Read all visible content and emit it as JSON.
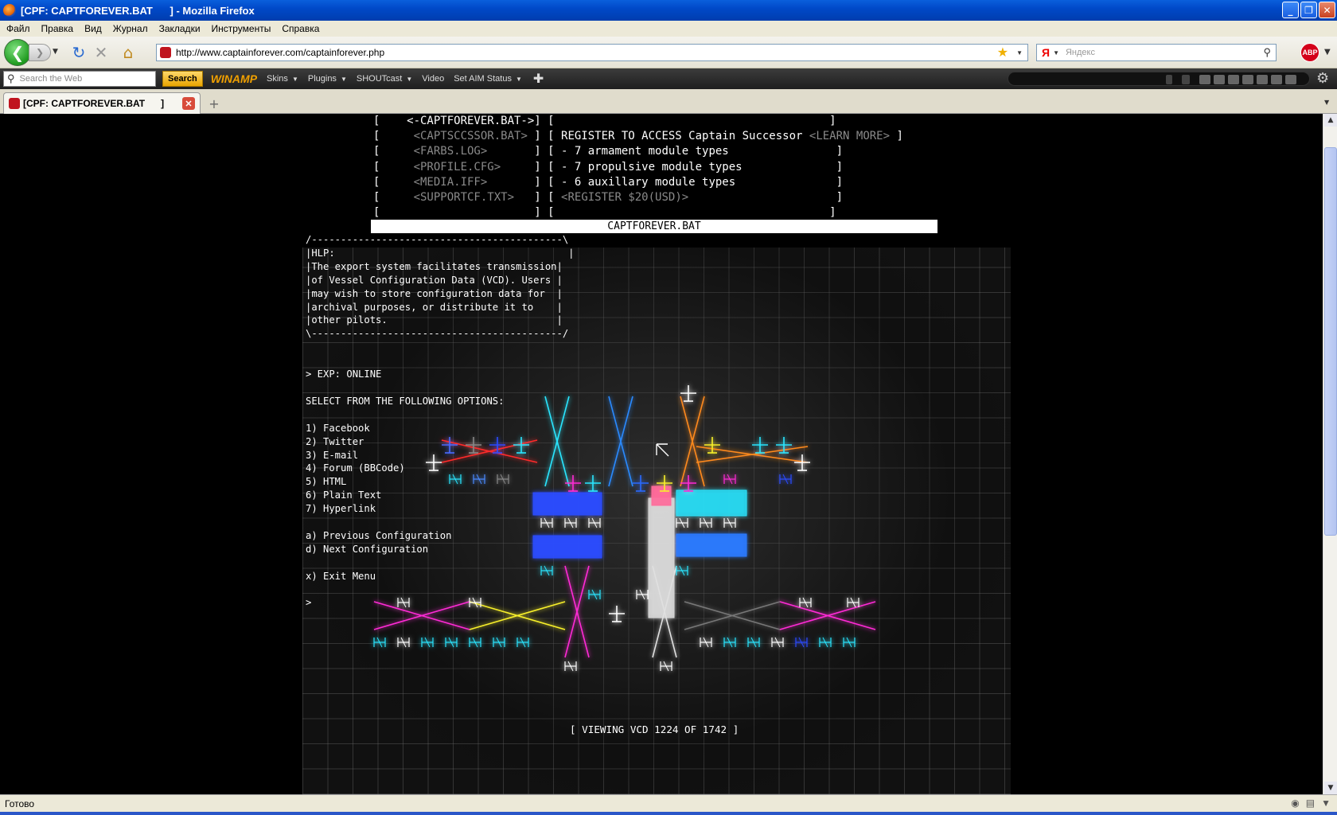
{
  "window": {
    "title": "[CPF: CAPTFOREVER.BAT      ] - Mozilla Firefox",
    "minimize": "_",
    "maximize": "❐",
    "close": "✕"
  },
  "menubar": [
    "Файл",
    "Правка",
    "Вид",
    "Журнал",
    "Закладки",
    "Инструменты",
    "Справка"
  ],
  "nav": {
    "url": "http://www.captainforever.com/captainforever.php",
    "search_engine_glyph": "Я",
    "search_placeholder": "Яндекс",
    "abp": "ABP"
  },
  "winamp": {
    "search_placeholder": "Search the Web",
    "search_button": "Search",
    "logo": "WINAMP",
    "items": [
      "Skins",
      "Plugins",
      "SHOUTcast",
      "Video",
      "Set AIM Status"
    ]
  },
  "tab": {
    "label": "[CPF: CAPTFOREVER.BAT      ]"
  },
  "game_menu": {
    "lines": [
      "[    <-CAPTFOREVER.BAT->] [                                         ]",
      "[     <CAPTSCCSSOR.BAT> ] [ REGISTER TO ACCESS Captain Successor <LEARN MORE> ]",
      "[     <FARBS.LOG>       ] [ - 7 armament module types                ]",
      "[     <PROFILE.CFG>     ] [ - 7 propulsive module types              ]",
      "[     <MEDIA.IFF>       ] [ - 6 auxillary module types               ]",
      "[     <SUPPORTCF.TXT>   ] [ <REGISTER $20(USD)>                      ]",
      "[                       ] [                                         ]"
    ],
    "links": [
      "<CAPTSCCSSOR.BAT>",
      "<FARBS.LOG>",
      "<PROFILE.CFG>",
      "<MEDIA.IFF>",
      "<SUPPORTCF.TXT>",
      "<LEARN MORE>",
      "<REGISTER $20(USD)>"
    ],
    "title_bar": "CAPTFOREVER.BAT"
  },
  "console": {
    "text": "/-------------------------------------------\\\n|HLP:                                        |\n|The export system facilitates transmission|\n|of Vessel Configuration Data (VCD). Users |\n|may wish to store configuration data for  |\n|archival purposes, or distribute it to    |\n|other pilots.                             |\n\\-------------------------------------------/\n\n\n> EXP: ONLINE\n\nSELECT FROM THE FOLLOWING OPTIONS:\n\n1) Facebook\n2) Twitter\n3) E-mail\n4) Forum (BBCode)\n5) HTML\n6) Plain Text\n7) Hyperlink\n\na) Previous Configuration\nd) Next Configuration\n\nx) Exit Menu\n\n>"
  },
  "viewing": "[ VIEWING VCD 1224 OF 1742 ]",
  "colors": {
    "cyan": "#29e6ff",
    "blue": "#2b4cff",
    "orange": "#ff8a1c",
    "magenta": "#ff2bd6",
    "yellow": "#f8f02a",
    "red": "#ff2a2a",
    "white": "#ffffff",
    "gray": "#8a8a8a"
  },
  "status": {
    "text": "Готово"
  }
}
